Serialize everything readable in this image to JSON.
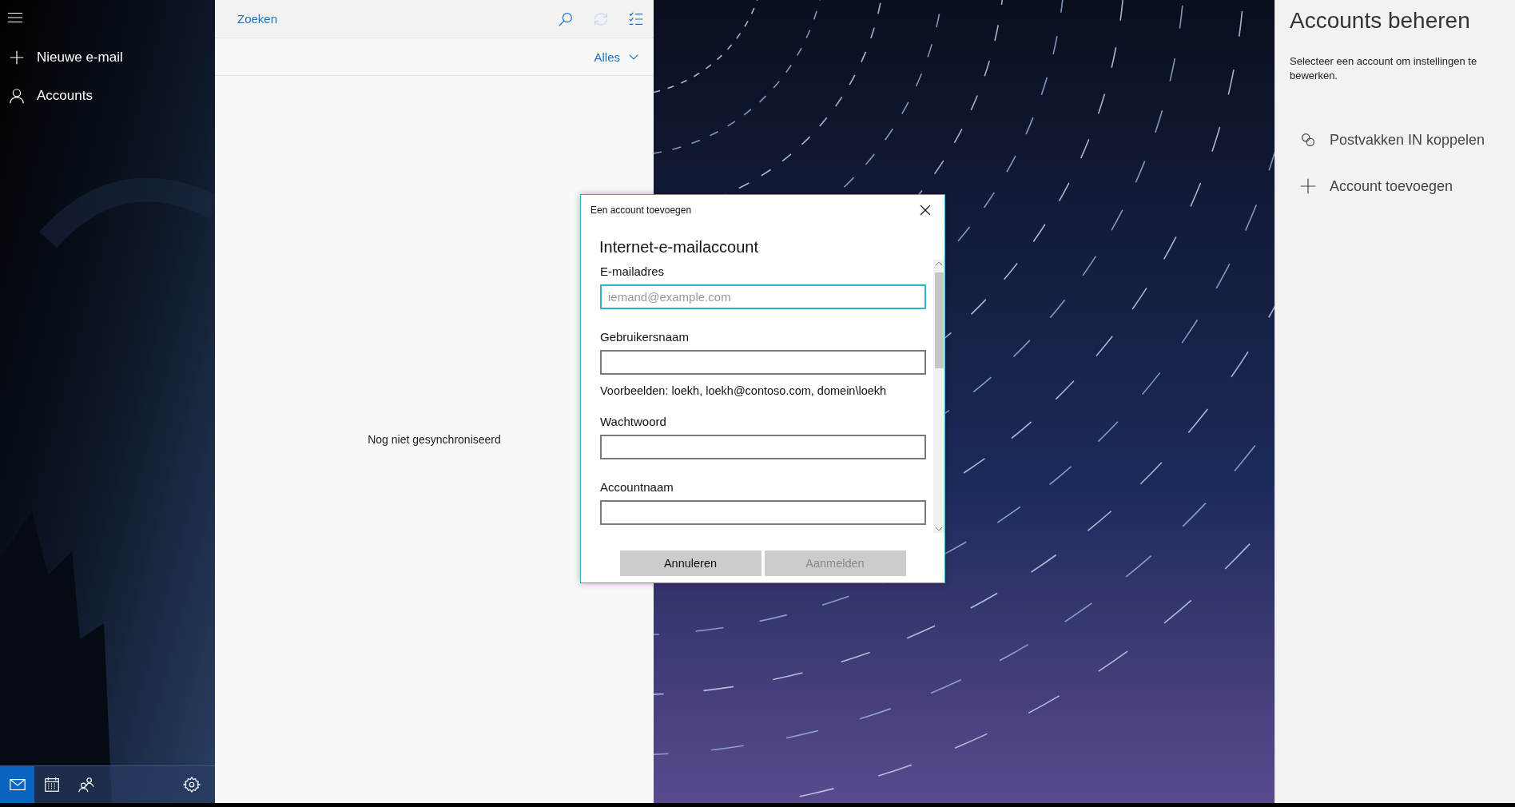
{
  "sidebar": {
    "items": [
      {
        "kind": "new",
        "label": "Nieuwe e-mail"
      },
      {
        "kind": "accounts",
        "label": "Accounts"
      }
    ],
    "bottom_nav": [
      {
        "kind": "mail",
        "selected": true
      },
      {
        "kind": "calendar",
        "selected": false
      },
      {
        "kind": "people",
        "selected": false
      },
      {
        "kind": "settings",
        "selected": false
      }
    ]
  },
  "message_list": {
    "search": {
      "placeholder": "Zoeken"
    },
    "sync_disabled": true,
    "filter": "Alles",
    "empty_message": "Nog niet gesynchroniseerd"
  },
  "accounts_panel": {
    "title": "Accounts beheren",
    "description": "Selecteer een account om instellingen te bewerken.",
    "actions": [
      {
        "kind": "link",
        "label": "Postvakken IN koppelen"
      },
      {
        "kind": "add",
        "label": "Account toevoegen"
      }
    ]
  },
  "dialog": {
    "title": "Een account toevoegen",
    "heading": "Internet-e-mailaccount",
    "fields": [
      {
        "label": "E-mailadres",
        "placeholder": "iemand@example.com",
        "focused": true
      },
      {
        "label": "Gebruikersnaam",
        "focused": false,
        "hint": "Voorbeelden: loekh, loekh@contoso.com, domein\\loekh"
      },
      {
        "label": "Wachtwoord",
        "focused": false
      },
      {
        "label": "Accountnaam",
        "focused": false
      }
    ],
    "buttons": [
      {
        "label": "Annuleren",
        "disabled": false
      },
      {
        "label": "Aanmelden",
        "disabled": true
      }
    ]
  }
}
